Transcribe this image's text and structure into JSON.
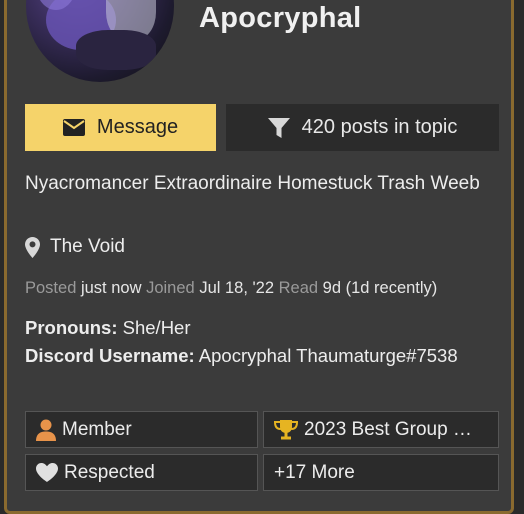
{
  "user": {
    "username": "Apocryphal",
    "title": "Nyacromancer Extraordinaire Homestuck Trash Weeb",
    "location": "The Void"
  },
  "actions": {
    "message_label": "Message",
    "posts_filter_label": "420 posts in topic"
  },
  "meta": {
    "posted_label": "Posted",
    "posted_value": "just now",
    "joined_label": "Joined",
    "joined_value": "Jul 18, '22",
    "read_label": "Read",
    "read_value": "9d (1d recently)"
  },
  "fields": [
    {
      "label": "Pronouns:",
      "value": "She/Her"
    },
    {
      "label": "Discord Username:",
      "value": "Apocryphal Thaumaturge#7538"
    }
  ],
  "badges": [
    {
      "label": "Member",
      "icon": "user-icon",
      "color": "#e8934a"
    },
    {
      "label": "2023 Best Group …",
      "icon": "trophy-icon",
      "color": "#e6b422"
    },
    {
      "label": "Respected",
      "icon": "heart-icon",
      "color": "#e0e0e0"
    },
    {
      "label": "+17 More"
    }
  ],
  "colors": {
    "accent": "#f5d36a",
    "border": "#8a6a2f",
    "card_bg": "#3b3b3b"
  }
}
